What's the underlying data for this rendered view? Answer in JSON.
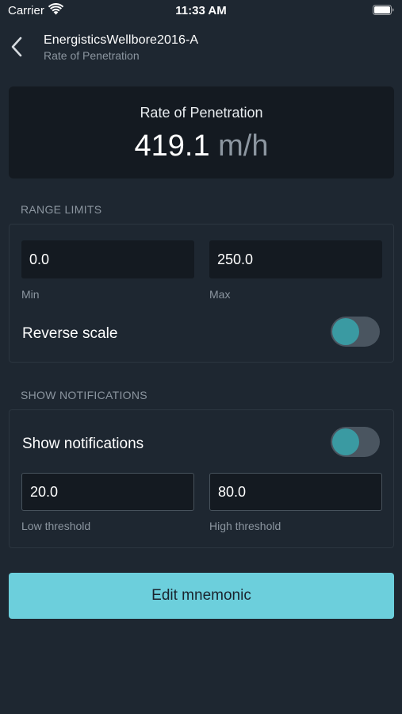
{
  "status_bar": {
    "carrier": "Carrier",
    "time": "11:33 AM",
    "wifi_icon": "wifi-icon",
    "battery_icon": "battery-full-icon"
  },
  "nav": {
    "back_icon": "chevron-left-icon",
    "title": "EnergisticsWellbore2016-A",
    "subtitle": "Rate of Penetration"
  },
  "value_card": {
    "label": "Rate of Penetration",
    "value": "419.1",
    "unit": "m/h"
  },
  "range_limits": {
    "header": "RANGE LIMITS",
    "min_value": "0.0",
    "min_label": "Min",
    "max_value": "250.0",
    "max_label": "Max",
    "reverse_scale_label": "Reverse scale",
    "reverse_scale_on": true
  },
  "notifications": {
    "header": "SHOW NOTIFICATIONS",
    "show_label": "Show notifications",
    "show_on": true,
    "low_value": "20.0",
    "low_label": "Low threshold",
    "high_value": "80.0",
    "high_label": "High threshold"
  },
  "actions": {
    "edit_label": "Edit mnemonic"
  },
  "colors": {
    "background": "#1e2731",
    "card": "#141a21",
    "accent": "#6ccfdc",
    "toggle_knob": "#3a9aa2"
  }
}
